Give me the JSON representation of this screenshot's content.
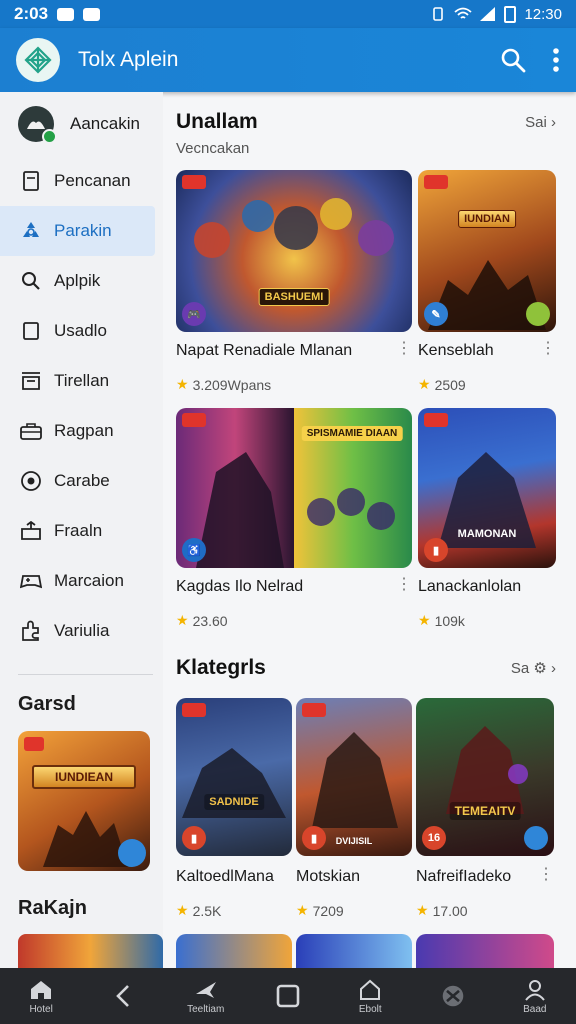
{
  "status_bar": {
    "time": "2:03",
    "clock_right": "12:30"
  },
  "app_bar": {
    "title": "Tolx Aplein"
  },
  "drawer": {
    "account_label": "Aancakin",
    "items": [
      {
        "label": "Pencanan",
        "icon": "document-icon"
      },
      {
        "label": "Parakin",
        "icon": "recycle-icon",
        "active": true
      },
      {
        "label": "Aplpik",
        "icon": "search-icon"
      },
      {
        "label": "Usadlo",
        "icon": "square-icon"
      },
      {
        "label": "Tirellan",
        "icon": "store-icon"
      },
      {
        "label": "Ragpan",
        "icon": "briefcase-icon"
      },
      {
        "label": "Carabe",
        "icon": "compass-icon"
      },
      {
        "label": "Fraaln",
        "icon": "share-icon"
      },
      {
        "label": "Marcaion",
        "icon": "gamepad-icon"
      },
      {
        "label": "Variulia",
        "icon": "puzzle-icon"
      }
    ],
    "section_title": "Garsd",
    "featured_card": {
      "title": "IUNDIEAN"
    },
    "section_title_2": "RaKajn"
  },
  "main": {
    "section1": {
      "title": "Unallam",
      "subtitle": "Vecncakan",
      "see_all": "Sai",
      "row1": [
        {
          "name": "Napat Renadiale Mlanan",
          "rating": "3.209Wpans",
          "banner": "BASHUEMI"
        },
        {
          "name": "Kenseblah",
          "rating": "2509",
          "banner": "IUNDIAN"
        }
      ],
      "row2": [
        {
          "name": "Kagdas Ilo Nelrad",
          "rating": "23.60",
          "banner": "SPISMAMIE DIAAN"
        },
        {
          "name": "Lanackanlolan",
          "rating": "109k",
          "banner": "MAMONAN"
        }
      ]
    },
    "section2": {
      "title": "Klategrls",
      "see_all": "Sa",
      "items": [
        {
          "name": "KaltoedlMana",
          "rating": "2.5K",
          "banner": "SADNIDE"
        },
        {
          "name": "Motskian",
          "rating": "7209",
          "banner": "DVIJISIL"
        },
        {
          "name": "NafreifIadeko",
          "rating": "17.00",
          "banner": "TEMEAITV"
        }
      ]
    }
  },
  "bottom_nav": [
    {
      "label": "Hotel",
      "icon": "home-icon"
    },
    {
      "label": "",
      "icon": "back-icon"
    },
    {
      "label": "Teeltiam",
      "icon": "bird-icon"
    },
    {
      "label": "",
      "icon": "square-home-icon"
    },
    {
      "label": "Ebolt",
      "icon": "house-icon"
    },
    {
      "label": "",
      "icon": "globe-icon"
    },
    {
      "label": "Baad",
      "icon": "person-icon"
    }
  ]
}
